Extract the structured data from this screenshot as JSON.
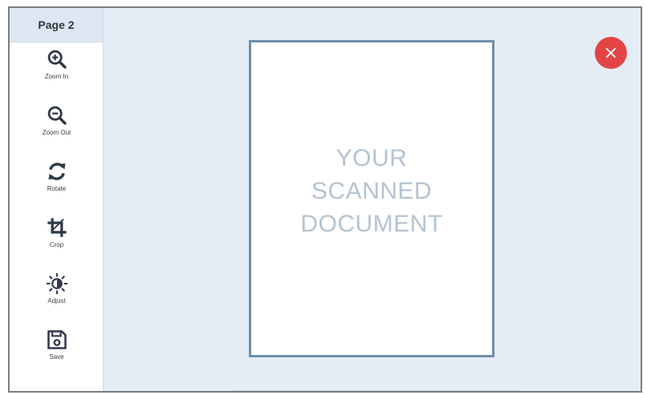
{
  "sidebar": {
    "page_label": "Page 2",
    "tools": [
      {
        "id": "zoom-in",
        "label": "Zoom In",
        "icon": "zoom-in-icon"
      },
      {
        "id": "zoom-out",
        "label": "Zoom Out",
        "icon": "zoom-out-icon"
      },
      {
        "id": "rotate",
        "label": "Rotate",
        "icon": "rotate-icon"
      },
      {
        "id": "crop",
        "label": "Crop",
        "icon": "crop-icon"
      },
      {
        "id": "adjust",
        "label": "Adjust",
        "icon": "adjust-brightness-icon"
      },
      {
        "id": "save",
        "label": "Save",
        "icon": "save-icon"
      }
    ]
  },
  "document": {
    "placeholder_lines": [
      "YOUR",
      "SCANNED",
      "DOCUMENT"
    ]
  },
  "close_button": {
    "icon": "close-icon",
    "color": "#e34545"
  },
  "colors": {
    "icon": "#2f3a4b",
    "document_border": "#6f8fab",
    "canvas": "#e4edf6",
    "placeholder_text": "#b4c3d2"
  }
}
